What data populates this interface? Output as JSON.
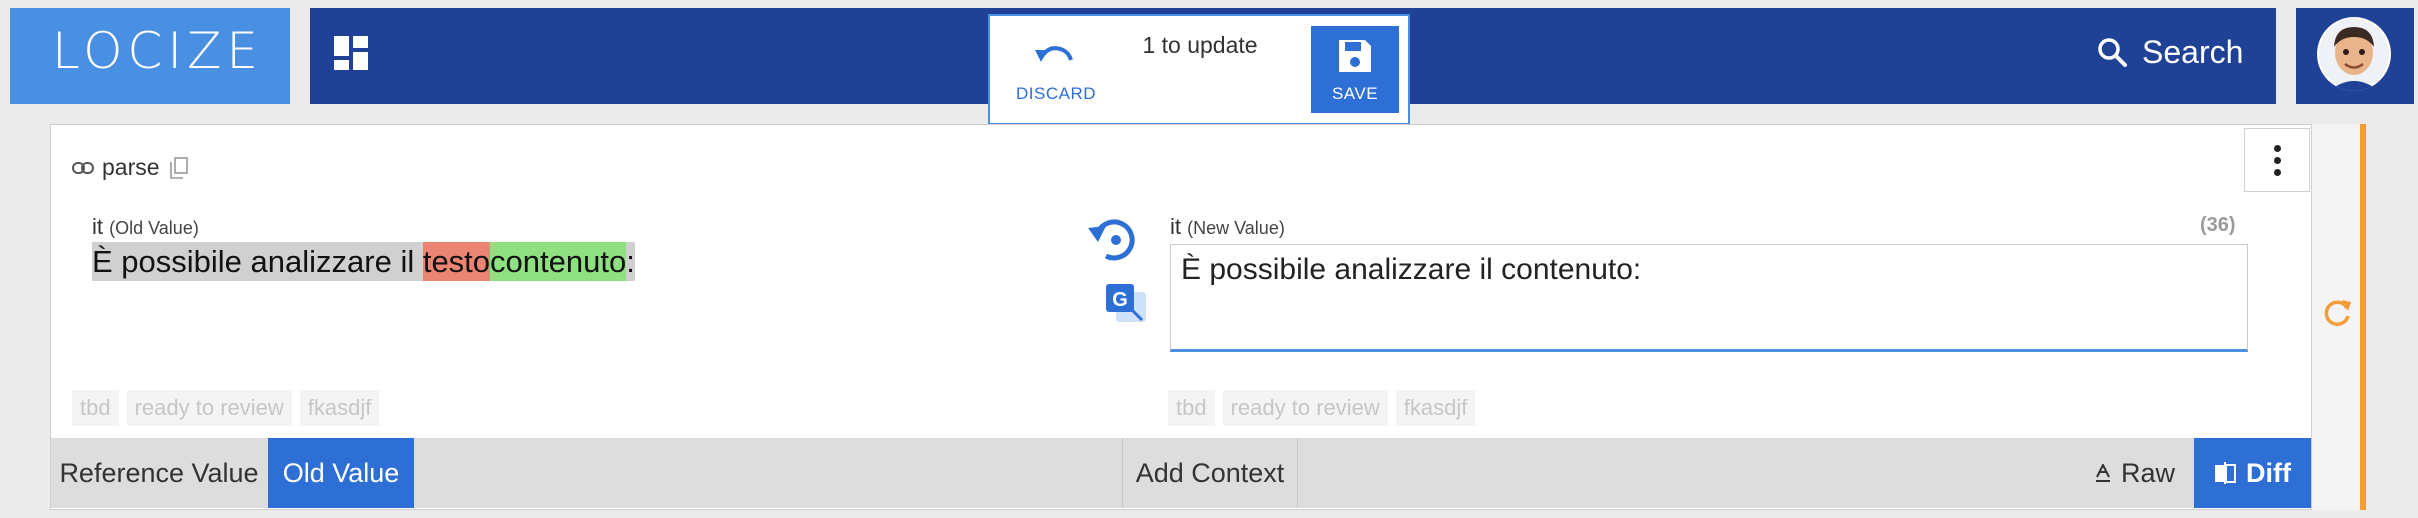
{
  "header": {
    "logo": "LOCIZE",
    "search_label": "Search",
    "icons": {
      "dashboard": "dashboard-icon",
      "search": "search-icon",
      "avatar": "avatar"
    }
  },
  "update_popup": {
    "discard_label": "DISCARD",
    "update_text": "1 to update",
    "save_label": "SAVE"
  },
  "segment": {
    "key": "parse",
    "old": {
      "lang": "it",
      "label": "(Old Value)",
      "text_before": "È possibile analizzare il ",
      "deleted": "testo",
      "inserted": "contenuto",
      "text_after": ":"
    },
    "new": {
      "lang": "it",
      "label": "(New Value)",
      "char_count": "(36)",
      "value": "È possibile analizzare il contenuto:"
    },
    "tags_old": [
      "tbd",
      "ready to review",
      "fkasdjf"
    ],
    "tags_new": [
      "tbd",
      "ready to review",
      "fkasdjf"
    ]
  },
  "bottom_tabs": {
    "reference": "Reference Value",
    "old_value": "Old Value",
    "add_context": "Add Context",
    "raw": "Raw",
    "diff": "Diff"
  },
  "colors": {
    "brand_light": "#4a90e2",
    "brand_dark": "#1f4196",
    "accent_blue": "#2e6fd6",
    "orange": "#f39c3a",
    "diff_deleted": "#ec8474",
    "diff_inserted": "#8fe080"
  }
}
